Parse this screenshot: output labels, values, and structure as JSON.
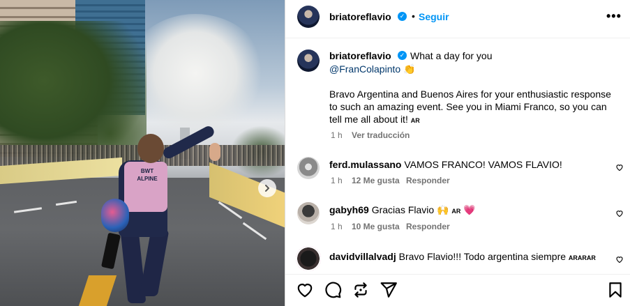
{
  "header": {
    "username": "briatoreflavio",
    "separator": "•",
    "follow_label": "Seguir",
    "more_label": "•••"
  },
  "caption": {
    "username": "briatoreflavio",
    "line1": "What a day for you",
    "mention": "@FranColapinto",
    "emoji": "👏",
    "line3": "Bravo Argentina and Buenos Aires for your enthusiastic response",
    "line4": "to such an amazing event. See you in Miami Franco, so you can",
    "line5": "tell me all about it!",
    "flag": "AR",
    "time": "1 h",
    "translate": "Ver traducción"
  },
  "comments": [
    {
      "username": "ferd.mulassano",
      "text": "VAMOS FRANCO! VAMOS FLAVIO!",
      "time": "1 h",
      "likes": "12 Me gusta",
      "reply": "Responder"
    },
    {
      "username": "gabyh69",
      "text": "Gracias Flavio",
      "emoji": "🙌",
      "flag": "AR",
      "heart": "💗",
      "time": "1 h",
      "likes": "10 Me gusta",
      "reply": "Responder"
    },
    {
      "username": "davidvillalvadj",
      "text": "Bravo Flavio!!! Todo argentina siempre",
      "flags": "ARARAR"
    }
  ],
  "photo": {
    "vest_text": "BWT\nALPINE"
  },
  "colors": {
    "accent": "#0095f6",
    "mention": "#00376b",
    "meta": "#737373"
  },
  "icons": [
    "heart-icon",
    "comment-icon",
    "share-icon",
    "send-icon",
    "bookmark-icon",
    "chevron-right-icon",
    "verified-icon"
  ]
}
